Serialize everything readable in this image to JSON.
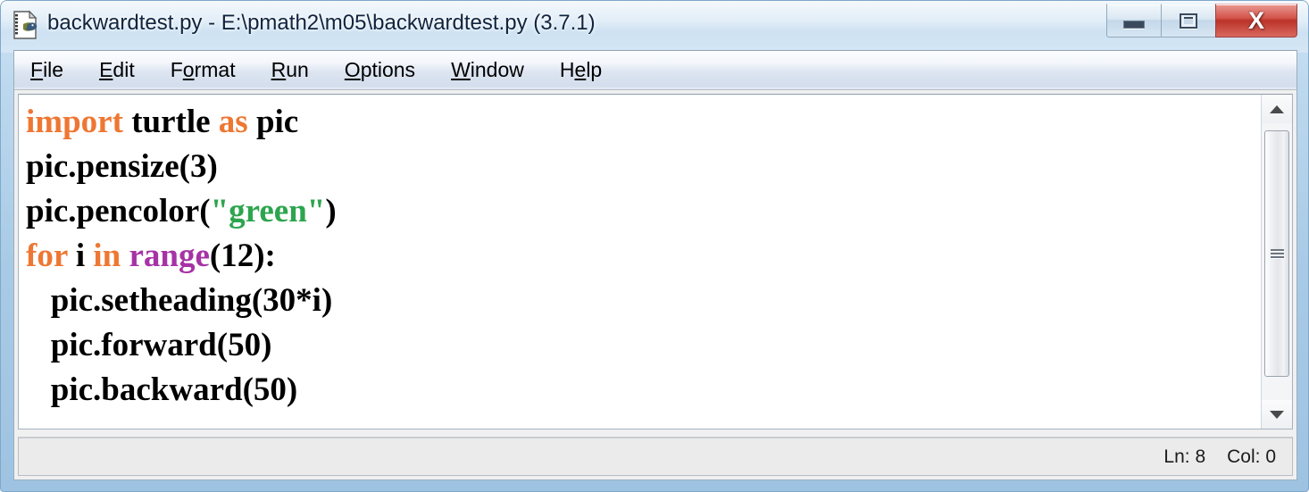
{
  "window": {
    "title": "backwardtest.py - E:\\pmath2\\m05\\backwardtest.py (3.7.1)",
    "icon_name": "python-idle-file-icon",
    "controls": {
      "minimize_label": "—",
      "maximize_label": "□",
      "close_label": "X"
    }
  },
  "menubar": {
    "items": [
      {
        "pre": "",
        "accel": "F",
        "post": "ile"
      },
      {
        "pre": "",
        "accel": "E",
        "post": "dit"
      },
      {
        "pre": "F",
        "accel": "o",
        "post": "rmat"
      },
      {
        "pre": "",
        "accel": "R",
        "post": "un"
      },
      {
        "pre": "",
        "accel": "O",
        "post": "ptions"
      },
      {
        "pre": "",
        "accel": "W",
        "post": "indow"
      },
      {
        "pre": "H",
        "accel": "e",
        "post": "lp"
      }
    ]
  },
  "editor": {
    "lines": [
      [
        {
          "t": "import",
          "c": "kw"
        },
        {
          "t": " turtle ",
          "c": "def"
        },
        {
          "t": "as",
          "c": "kw"
        },
        {
          "t": " pic",
          "c": "def"
        }
      ],
      [
        {
          "t": "pic.pensize(3)",
          "c": "def"
        }
      ],
      [
        {
          "t": "pic.pencolor(",
          "c": "def"
        },
        {
          "t": "\"green\"",
          "c": "str"
        },
        {
          "t": ")",
          "c": "def"
        }
      ],
      [
        {
          "t": "for",
          "c": "kw"
        },
        {
          "t": " i ",
          "c": "def"
        },
        {
          "t": "in",
          "c": "kw"
        },
        {
          "t": " ",
          "c": "def"
        },
        {
          "t": "range",
          "c": "bi"
        },
        {
          "t": "(12):",
          "c": "def"
        }
      ],
      [
        {
          "t": "   pic.setheading(30*i)",
          "c": "def"
        }
      ],
      [
        {
          "t": "   pic.forward(50)",
          "c": "def"
        }
      ],
      [
        {
          "t": "   pic.backward(50)",
          "c": "def"
        }
      ]
    ],
    "colors": {
      "keyword": "#ee7733",
      "string": "#2da54e",
      "builtin": "#a633a6",
      "default": "#000000"
    }
  },
  "scrollbar": {
    "up_arrow": "scroll-up-arrow",
    "down_arrow": "scroll-down-arrow"
  },
  "statusbar": {
    "line_label": "Ln: 8",
    "col_label": "Col: 0"
  }
}
